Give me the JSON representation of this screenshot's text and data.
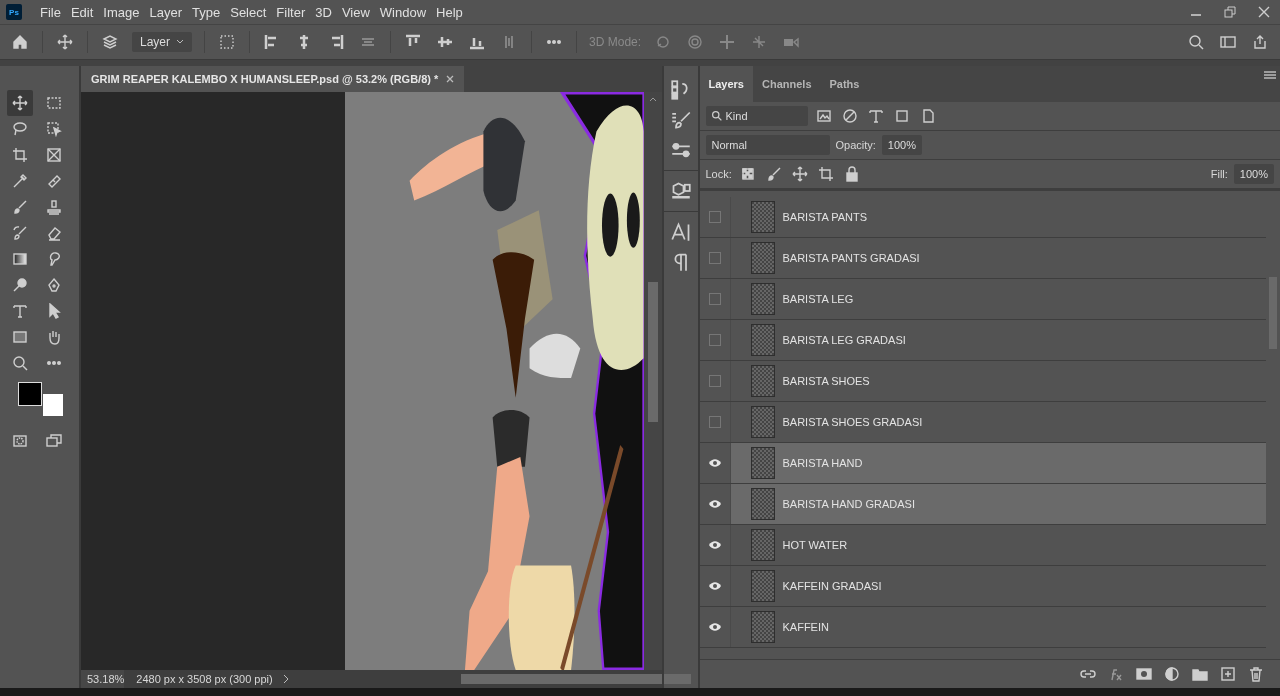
{
  "app_icon": "Ps",
  "menu": [
    "File",
    "Edit",
    "Image",
    "Layer",
    "Type",
    "Select",
    "Filter",
    "3D",
    "View",
    "Window",
    "Help"
  ],
  "options_bar": {
    "target_select": "Layer",
    "mode_label": "3D Mode:"
  },
  "tools": [
    {
      "kind": "move",
      "selected": true
    },
    {
      "kind": "marquee",
      "selected": false
    },
    {
      "kind": "lasso",
      "selected": false
    },
    {
      "kind": "object-select",
      "selected": false
    },
    {
      "kind": "crop",
      "selected": false
    },
    {
      "kind": "frame",
      "selected": false
    },
    {
      "kind": "eyedropper",
      "selected": false
    },
    {
      "kind": "bandage",
      "selected": false
    },
    {
      "kind": "brush",
      "selected": false
    },
    {
      "kind": "stamp",
      "selected": false
    },
    {
      "kind": "history-brush",
      "selected": false
    },
    {
      "kind": "eraser",
      "selected": false
    },
    {
      "kind": "gradient",
      "selected": false
    },
    {
      "kind": "smudge",
      "selected": false
    },
    {
      "kind": "dodge",
      "selected": false
    },
    {
      "kind": "pen",
      "selected": false
    },
    {
      "kind": "type",
      "selected": false
    },
    {
      "kind": "pointer",
      "selected": false
    },
    {
      "kind": "rectangle",
      "selected": false
    },
    {
      "kind": "hand",
      "selected": false
    },
    {
      "kind": "zoom",
      "selected": false
    },
    {
      "kind": "more",
      "selected": false
    }
  ],
  "document": {
    "tab_title": "GRIM REAPER KALEMBO X HUMANSLEEP.psd @ 53.2% (RGB/8) *",
    "zoom": "53.18%",
    "doc_info": "2480 px x 3508 px (300 ppi)"
  },
  "layers_panel": {
    "tabs": [
      {
        "label": "Layers",
        "selected": true
      },
      {
        "label": "Channels",
        "selected": false
      },
      {
        "label": "Paths",
        "selected": false
      }
    ],
    "filter": "Kind",
    "blend_mode": "Normal",
    "opacity_label": "Opacity:",
    "opacity": "100%",
    "lock_label": "Lock:",
    "fill_label": "Fill:",
    "fill": "100%",
    "layers": [
      {
        "name": "BARISTA PANTS",
        "visible": false,
        "selected": false
      },
      {
        "name": "BARISTA PANTS GRADASI",
        "visible": false,
        "selected": false
      },
      {
        "name": "BARISTA LEG",
        "visible": false,
        "selected": false
      },
      {
        "name": "BARISTA LEG GRADASI",
        "visible": false,
        "selected": false
      },
      {
        "name": "BARISTA SHOES",
        "visible": false,
        "selected": false
      },
      {
        "name": "BARISTA SHOES GRADASI",
        "visible": false,
        "selected": false
      },
      {
        "name": "BARISTA HAND",
        "visible": true,
        "selected": true
      },
      {
        "name": "BARISTA HAND GRADASI",
        "visible": true,
        "selected": true
      },
      {
        "name": "HOT WATER",
        "visible": true,
        "selected": false
      },
      {
        "name": "KAFFEIN GRADASI",
        "visible": true,
        "selected": false
      },
      {
        "name": "KAFFEIN",
        "visible": true,
        "selected": false
      }
    ]
  }
}
